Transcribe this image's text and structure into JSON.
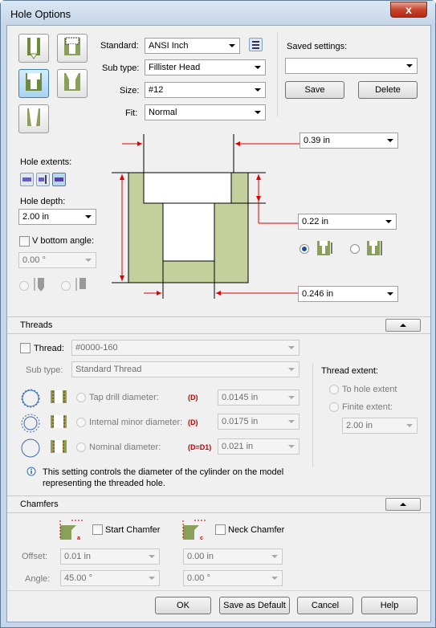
{
  "window": {
    "title": "Hole Options",
    "close": "x"
  },
  "standard": {
    "label": "Standard:",
    "value": "ANSI Inch"
  },
  "subtype": {
    "label": "Sub type:",
    "value": "Fillister Head"
  },
  "size": {
    "label": "Size:",
    "value": "#12"
  },
  "fit": {
    "label": "Fit:",
    "value": "Normal"
  },
  "saved": {
    "label": "Saved settings:",
    "value": "",
    "save": "Save",
    "delete": "Delete"
  },
  "hole_extents": {
    "label": "Hole extents:"
  },
  "hole_depth": {
    "label": "Hole depth:",
    "value": "2.00 in"
  },
  "v_bottom": {
    "label": "V bottom angle:",
    "value": "0.00 °"
  },
  "dims": {
    "head_dia": "0.39 in",
    "head_depth": "0.22 in",
    "hole_dia": "0.246 in"
  },
  "threads": {
    "header": "Threads",
    "thread_label": "Thread:",
    "thread_value": "#0000-160",
    "subtype_label": "Sub type:",
    "subtype_value": "Standard Thread",
    "tap_label": "Tap drill diameter:",
    "tap_code": "(D)",
    "tap_value": "0.0145 in",
    "minor_label": "Internal minor diameter:",
    "minor_code": "(D)",
    "minor_value": "0.0175 in",
    "nominal_label": "Nominal diameter:",
    "nominal_code": "(D=D1)",
    "nominal_value": "0.021 in",
    "info_line1": "This setting controls the diameter of the cylinder on the model",
    "info_line2": "representing the threaded hole.",
    "extent_label": "Thread extent:",
    "to_hole": "To hole extent",
    "finite": "Finite extent:",
    "finite_value": "2.00 in"
  },
  "chamfers": {
    "header": "Chamfers",
    "start": "Start Chamfer",
    "neck": "Neck Chamfer",
    "offset_label": "Offset:",
    "angle_label": "Angle:",
    "offset1": "0.01 in",
    "offset2": "0.00 in",
    "angle1": "45.00 °",
    "angle2": "0.00 °"
  },
  "footer": {
    "ok": "OK",
    "save_default": "Save as Default",
    "cancel": "Cancel",
    "help": "Help"
  },
  "colors": {
    "hole_fill": "#c3d09b",
    "dim_red": "#e00000",
    "selected_blue": "#a9d3f2"
  }
}
